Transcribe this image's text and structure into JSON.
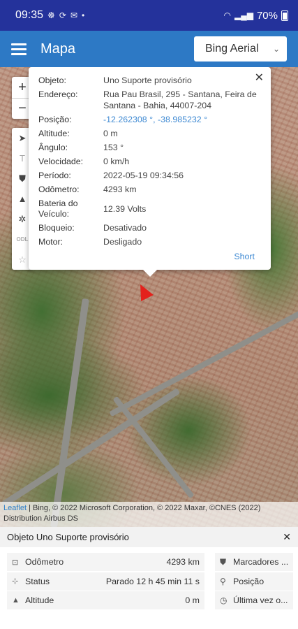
{
  "status_bar": {
    "time": "09:35",
    "battery": "70%"
  },
  "app_bar": {
    "title": "Mapa",
    "layer": "Bing Aerial"
  },
  "map": {
    "zoom_in": "+",
    "zoom_out": "−",
    "attribution_link": "Leaflet",
    "attribution_text": "| Bing, © 2022 Microsoft Corporation, © 2022 Maxar, ©CNES (2022) Distribution Airbus DS"
  },
  "popup": {
    "rows": [
      {
        "k": "Objeto:",
        "v": "Uno Suporte provisório"
      },
      {
        "k": "Endereço:",
        "v": "Rua Pau Brasil, 295 - Santana, Feira de Santana - Bahia, 44007-204"
      },
      {
        "k": "Posição:",
        "v": "-12.262308 °, -38.985232 °"
      },
      {
        "k": "Altitude:",
        "v": "0 m"
      },
      {
        "k": "Ângulo:",
        "v": "153 °"
      },
      {
        "k": "Velocidade:",
        "v": "0 km/h"
      },
      {
        "k": "Período:",
        "v": "2022-05-19 09:34:56"
      },
      {
        "k": "Odômetro:",
        "v": "4293 km"
      },
      {
        "k": "Bateria do Veículo:",
        "v": "12.39 Volts"
      },
      {
        "k": "Bloqueio:",
        "v": "Desativado"
      },
      {
        "k": "Motor:",
        "v": "Desligado"
      }
    ],
    "short_link": "Short"
  },
  "panel": {
    "title": "Objeto Uno Suporte provisório",
    "close": "✕",
    "stats": [
      {
        "icon": "odometer-icon",
        "label": "Odômetro",
        "value": "4293 km"
      },
      {
        "icon": "status-icon",
        "label": "Status",
        "value": "Parado 12 h 45 min 11 s"
      },
      {
        "icon": "altitude-icon",
        "label": "Altitude",
        "value": "0 m"
      }
    ],
    "actions": [
      {
        "icon": "shield-icon",
        "label": "Marcadores ..."
      },
      {
        "icon": "location-pin-icon",
        "label": "Posição"
      },
      {
        "icon": "clock-icon",
        "label": "Última vez o..."
      }
    ]
  }
}
